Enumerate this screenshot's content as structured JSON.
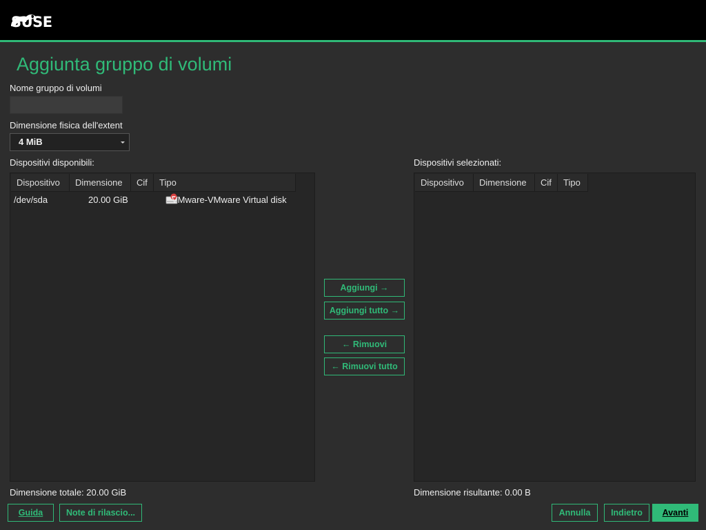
{
  "brand": {
    "logo_text": "SUSE",
    "accent_color": "#30ba78"
  },
  "title": "Aggiunta gruppo di volumi",
  "vg_name": {
    "label": "Nome gruppo di volumi",
    "value": ""
  },
  "extent": {
    "label": "Dimensione fisica dell'extent",
    "selected": "4 MiB"
  },
  "available": {
    "label": "Dispositivi disponibili:",
    "columns": [
      "Dispositivo",
      "Dimensione",
      "Cif",
      "Tipo"
    ],
    "rows": [
      {
        "device": "/dev/sda",
        "size": "20.00 GiB",
        "enc": "",
        "type": "VMware-VMware Virtual disk",
        "icon": "hard-disk-icon"
      }
    ],
    "total_label": "Dimensione totale:",
    "total_value": "20.00 GiB"
  },
  "selected": {
    "label": "Dispositivi selezionati:",
    "columns": [
      "Dispositivo",
      "Dimensione",
      "Cif",
      "Tipo"
    ],
    "rows": [],
    "result_label": "Dimensione risultante:",
    "result_value": "0.00 B"
  },
  "actions": {
    "add": "Aggiungi →",
    "add_all": "Aggiungi tutto →",
    "remove": "← Rimuovi",
    "remove_all": "← Rimuovi tutto"
  },
  "footer": {
    "help": "Guida",
    "release_notes": "Note di rilascio...",
    "cancel": "Annulla",
    "back": "Indietro",
    "next": "Avanti"
  }
}
